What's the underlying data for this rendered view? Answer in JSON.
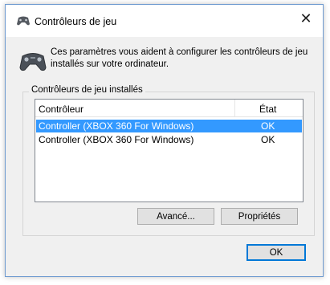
{
  "window": {
    "title": "Contrôleurs de jeu",
    "title_icon": "gamepad-icon",
    "close_glyph": "✕"
  },
  "header": {
    "icon": "gamepad-icon",
    "line1": "Ces paramètres vous aident à configurer les contrôleurs de jeu",
    "line2": "installés sur votre ordinateur."
  },
  "group": {
    "label": "Contrôleurs de jeu installés"
  },
  "list": {
    "columns": [
      "Contrôleur",
      "État"
    ],
    "rows": [
      {
        "name": "Controller (XBOX 360 For Windows)",
        "state": "OK",
        "selected": true
      },
      {
        "name": "Controller (XBOX 360 For Windows)",
        "state": "OK",
        "selected": false
      }
    ]
  },
  "buttons": {
    "advanced": "Avancé...",
    "properties": "Propriétés",
    "ok": "OK"
  },
  "colors": {
    "selection": "#3399ff",
    "window_border": "#6f9bd1",
    "default_button_border": "#0078d7"
  }
}
